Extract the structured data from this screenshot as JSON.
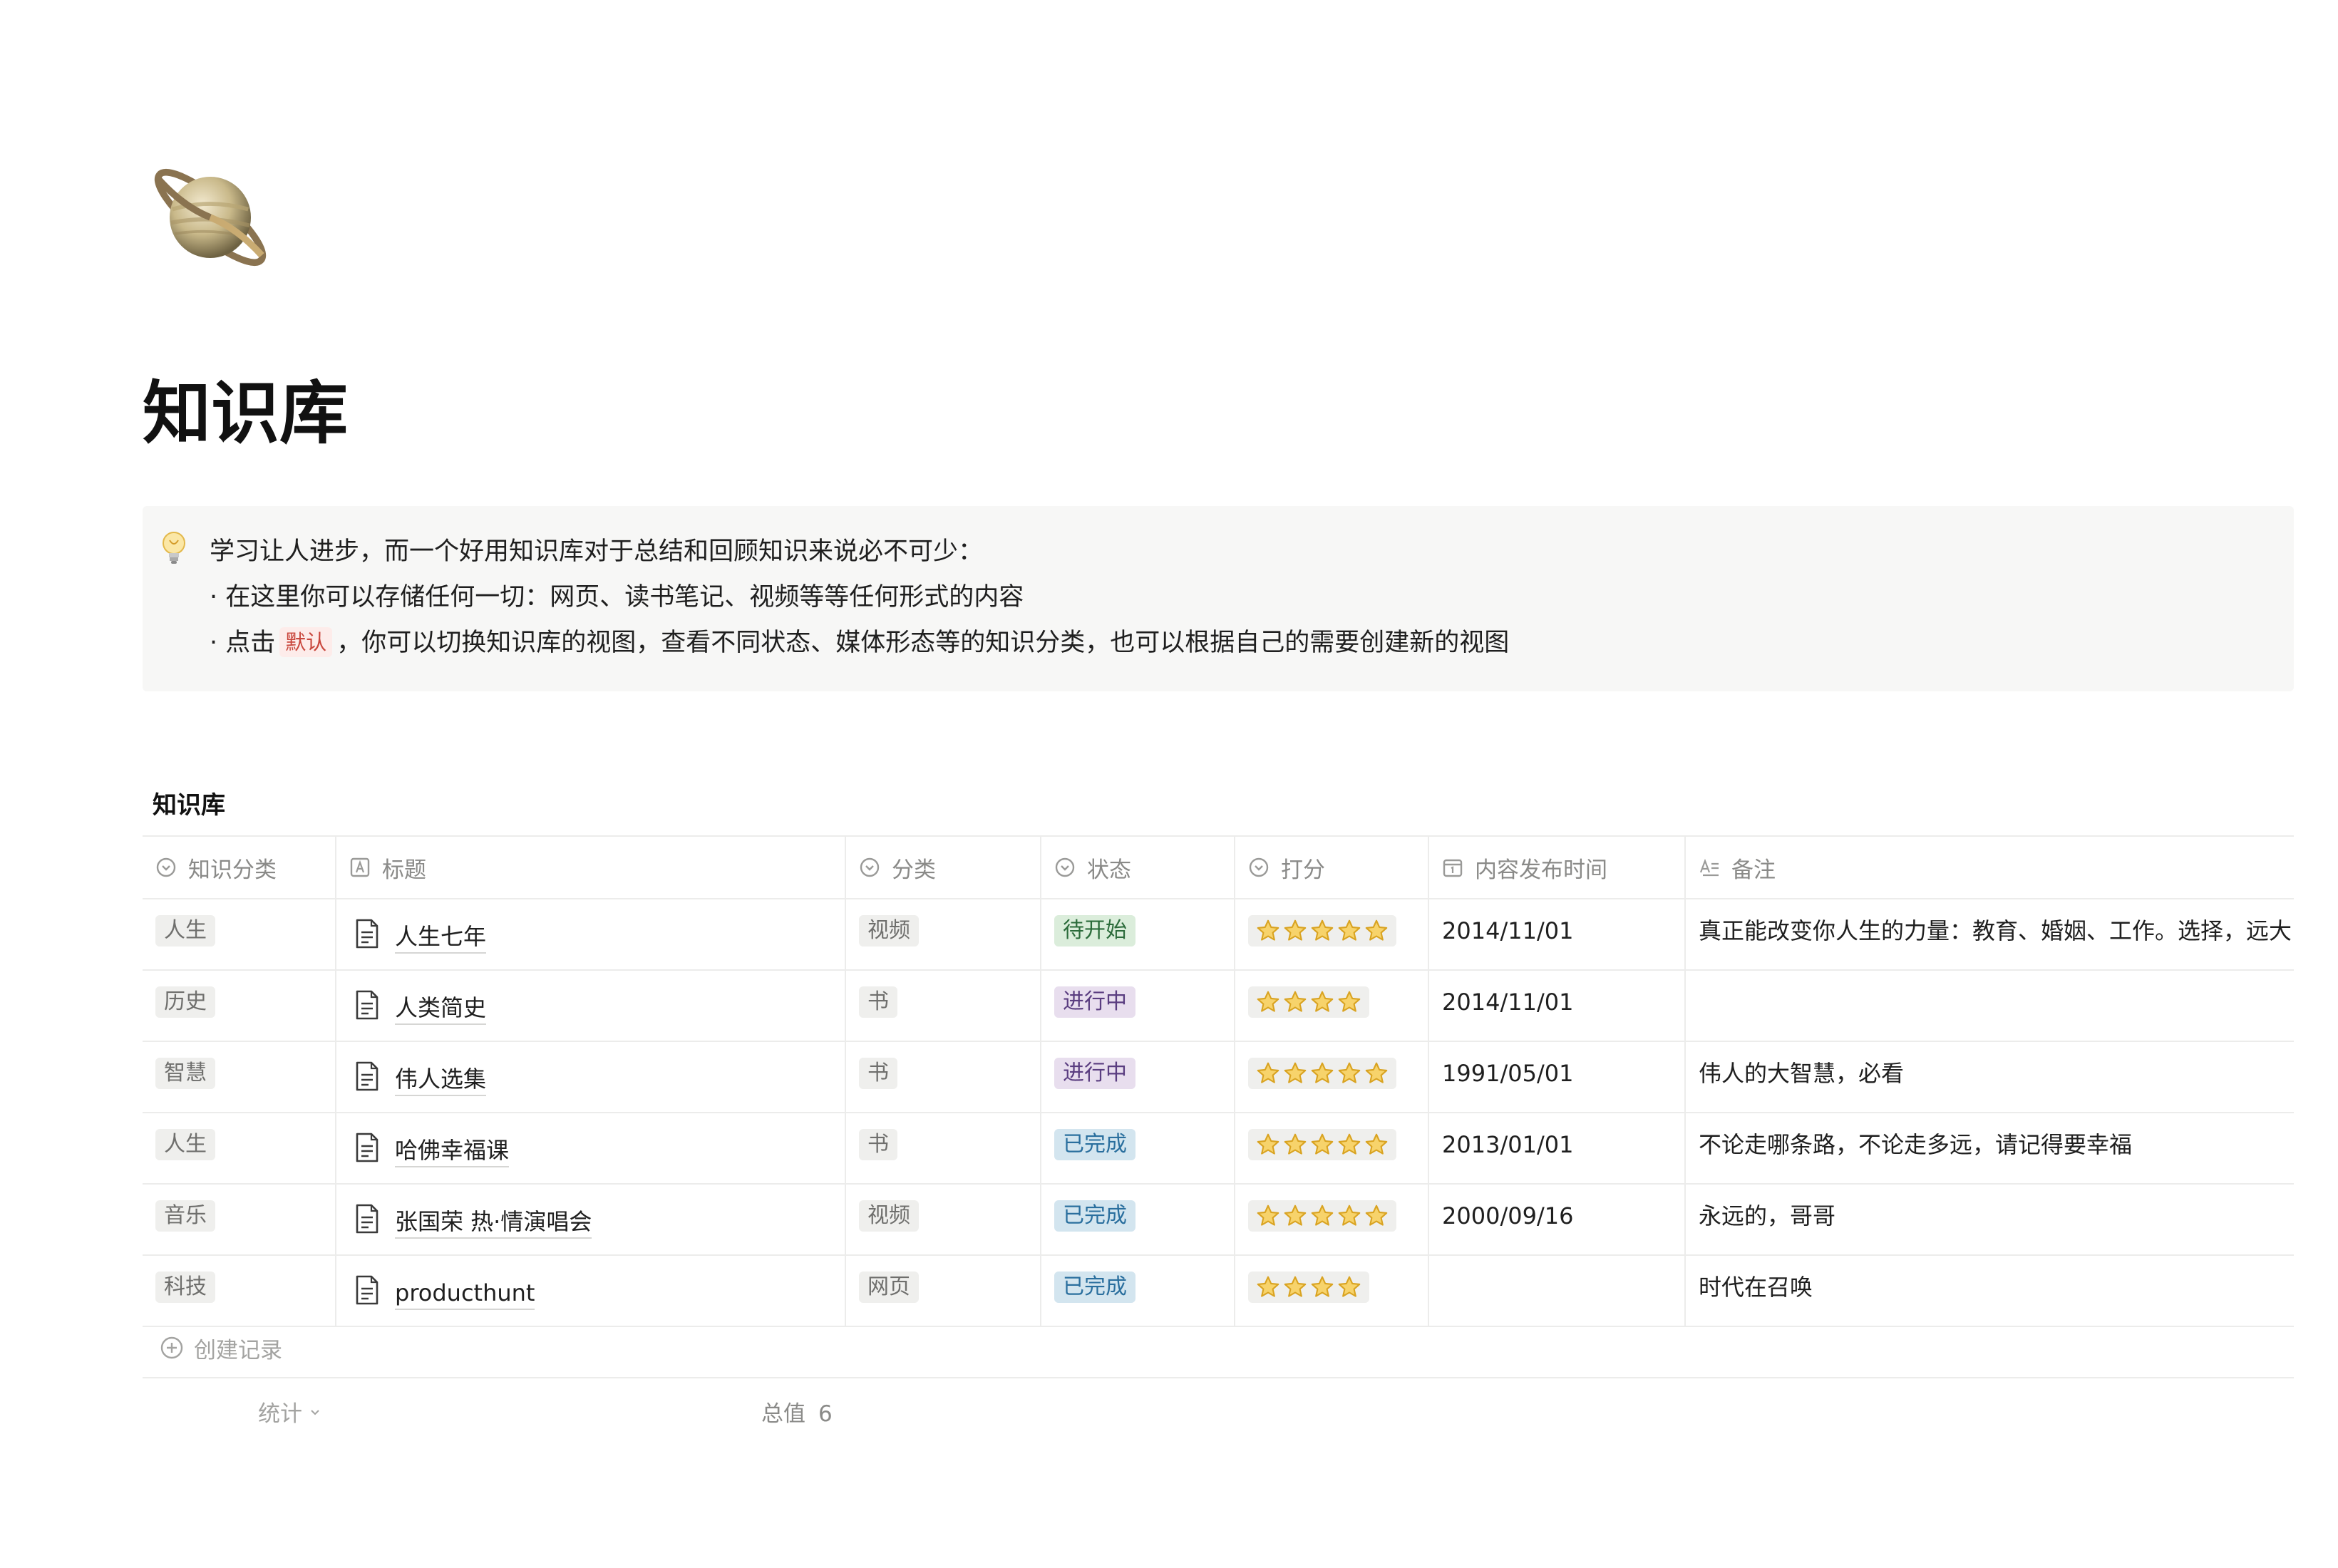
{
  "page": {
    "icon": "ringed-planet-icon",
    "title": "知识库"
  },
  "callout": {
    "icon": "lightbulb-icon",
    "line1": "学习让人进步，而一个好用知识库对于总结和回顾知识来说必不可少：",
    "line2": "· 在这里你可以存储任何一切：网页、读书笔记、视频等等任何形式的内容",
    "line3_prefix": "· 点击",
    "line3_tag": "默认",
    "line3_suffix": "，你可以切换知识库的视图，查看不同状态、媒体形态等的知识分类，也可以根据自己的需要创建新的视图"
  },
  "database": {
    "title": "知识库",
    "columns": [
      {
        "label": "知识分类",
        "icon": "select-icon"
      },
      {
        "label": "标题",
        "icon": "text-icon"
      },
      {
        "label": "分类",
        "icon": "select-icon"
      },
      {
        "label": "状态",
        "icon": "select-icon"
      },
      {
        "label": "打分",
        "icon": "select-icon"
      },
      {
        "label": "内容发布时间",
        "icon": "calendar-icon"
      },
      {
        "label": "备注",
        "icon": "text-lines-icon"
      }
    ],
    "rows": [
      {
        "category": "人生",
        "title": "人生七年",
        "type": "视频",
        "status": "待开始",
        "rating": 5,
        "date": "2014/11/01",
        "note": "真正能改变你人生的力量：教育、婚姻、工作。选择，远大"
      },
      {
        "category": "历史",
        "title": "人类简史",
        "type": "书",
        "status": "进行中",
        "rating": 4,
        "date": "2014/11/01",
        "note": ""
      },
      {
        "category": "智慧",
        "title": "伟人选集",
        "type": "书",
        "status": "进行中",
        "rating": 5,
        "date": "1991/05/01",
        "note": "伟人的大智慧，必看"
      },
      {
        "category": "人生",
        "title": "哈佛幸福课",
        "type": "书",
        "status": "已完成",
        "rating": 5,
        "date": "2013/01/01",
        "note": "不论走哪条路，不论走多远，请记得要幸福"
      },
      {
        "category": "音乐",
        "title": "张国荣 热·情演唱会",
        "type": "视频",
        "status": "已完成",
        "rating": 5,
        "date": "2000/09/16",
        "note": "永远的，哥哥"
      },
      {
        "category": "科技",
        "title": "producthunt",
        "type": "网页",
        "status": "已完成",
        "rating": 4,
        "date": "",
        "note": "时代在召唤"
      }
    ],
    "status_colors": {
      "待开始": {
        "bg": "#dbeddb",
        "fg": "#2b6b3a"
      },
      "进行中": {
        "bg": "#e8deee",
        "fg": "#5a3d80"
      },
      "已完成": {
        "bg": "#d3e5ef",
        "fg": "#2a6f9e"
      }
    },
    "add_row_label": "创建记录",
    "footer": {
      "stat_label": "统计",
      "total_label": "总值",
      "total_value": "6"
    }
  }
}
